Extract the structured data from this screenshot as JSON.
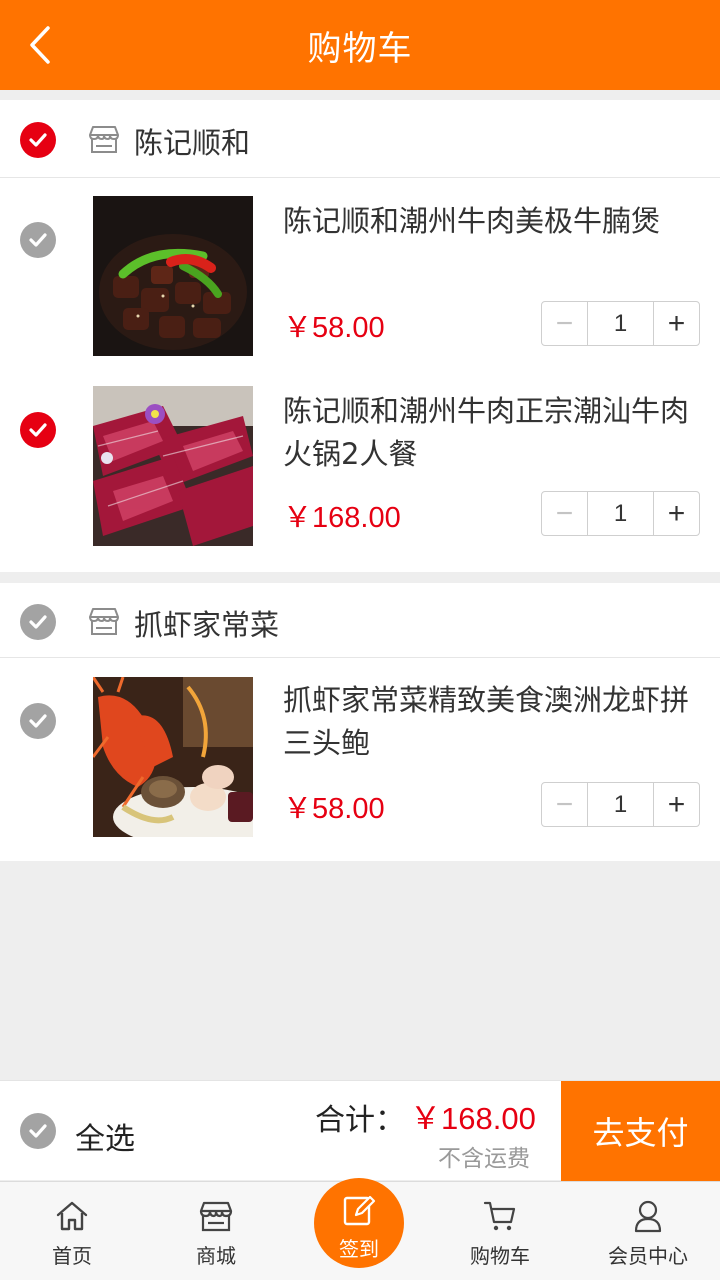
{
  "header": {
    "title": "购物车"
  },
  "shops": [
    {
      "name": "陈记顺和",
      "checked": true,
      "items": [
        {
          "name": "陈记顺和潮州牛肉美极牛腩煲",
          "price": "￥58.00",
          "qty": "1",
          "checked": false
        },
        {
          "name": "陈记顺和潮州牛肉正宗潮汕牛肉火锅2人餐",
          "price": "￥168.00",
          "qty": "1",
          "checked": true
        }
      ]
    },
    {
      "name": "抓虾家常菜",
      "checked": false,
      "items": [
        {
          "name": "抓虾家常菜精致美食澳洲龙虾拼三头鲍",
          "price": "￥58.00",
          "qty": "1",
          "checked": false
        }
      ]
    }
  ],
  "stepper": {
    "minus": "−",
    "plus": "+"
  },
  "checkout": {
    "select_all": "全选",
    "total_label": "合计：",
    "total_value": "￥168.00",
    "fee_note": "不含运费",
    "pay_button": "去支付"
  },
  "tabbar": {
    "home": "首页",
    "mall": "商城",
    "checkin": "签到",
    "cart": "购物车",
    "member": "会员中心"
  },
  "colors": {
    "brand": "#ff7300",
    "price": "#e60012",
    "checked": "#e60012",
    "unchecked": "#a3a3a3"
  }
}
